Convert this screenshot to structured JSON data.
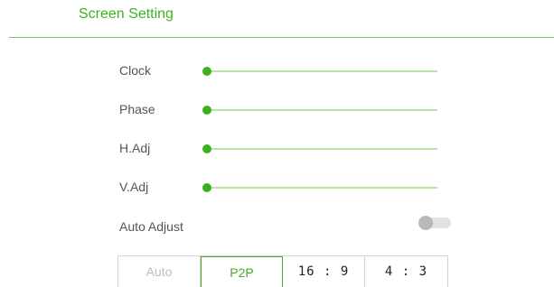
{
  "header": {
    "title": "Screen Setting"
  },
  "sliders": [
    {
      "label": "Clock",
      "value": 0
    },
    {
      "label": "Phase",
      "value": 0
    },
    {
      "label": "H.Adj",
      "value": 0
    },
    {
      "label": "V.Adj",
      "value": 0
    }
  ],
  "auto_adjust": {
    "label": "Auto Adjust",
    "enabled": false
  },
  "aspect_options": [
    {
      "label": "Auto",
      "state": "disabled"
    },
    {
      "label": "P2P",
      "state": "selected"
    },
    {
      "label": "16 : 9",
      "state": "normal"
    },
    {
      "label": "4 : 3",
      "state": "normal"
    }
  ],
  "colors": {
    "accent": "#3fae22",
    "track": "#b9e3a6",
    "toggle_off": "#b9b9b9"
  }
}
